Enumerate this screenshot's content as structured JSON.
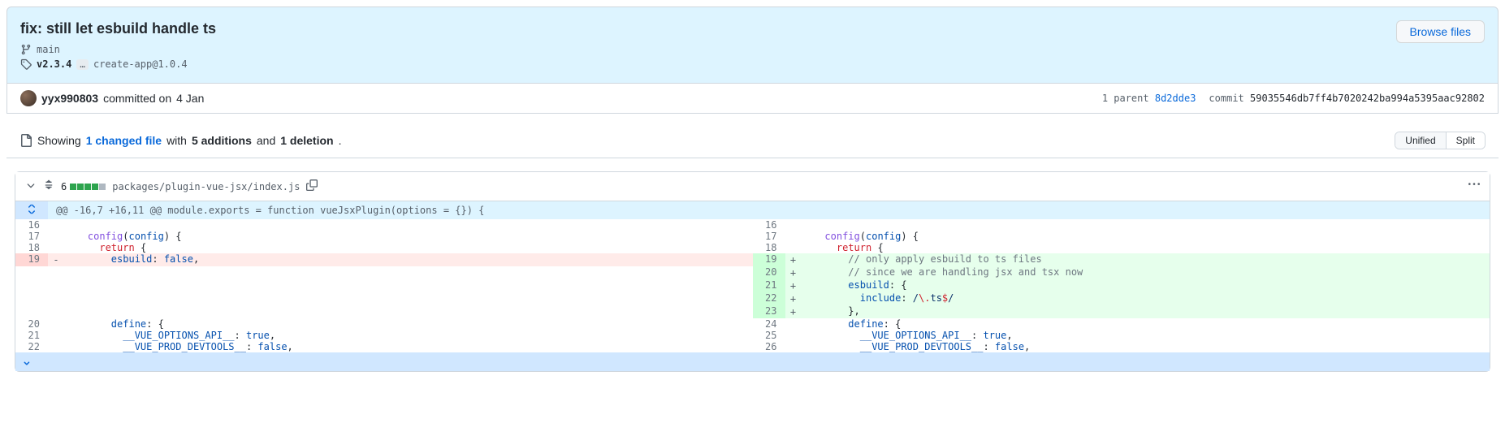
{
  "commit": {
    "title": "fix: still let esbuild handle ts",
    "browse_files": "Browse files",
    "branch": "main",
    "tag_primary": "v2.3.4",
    "tag_more": "…",
    "tag_secondary": "create-app@1.0.4",
    "author": "yyx990803",
    "committed_text": "committed on",
    "date": "4 Jan",
    "parent_label": "1 parent",
    "parent_sha": "8d2dde3",
    "commit_label": "commit",
    "full_sha": "59035546db7ff4b7020242ba994a5395aac92802"
  },
  "toolbar": {
    "showing": "Showing",
    "changed_files": "1 changed file",
    "with": "with",
    "additions": "5 additions",
    "and": "and",
    "deletions": "1 deletion",
    "period": ".",
    "unified": "Unified",
    "split": "Split"
  },
  "file": {
    "count": "6",
    "path": "packages/plugin-vue-jsx/index.js",
    "hunk": "@@ -16,7 +16,11 @@ module.exports = function vueJsxPlugin(options = {}) {"
  },
  "diff": {
    "left": [
      {
        "n": "16",
        "type": "ctx",
        "html": ""
      },
      {
        "n": "17",
        "type": "ctx",
        "html": "    <span class='pl-en'>config</span>(<span class='k-blue'>config</span>) {"
      },
      {
        "n": "18",
        "type": "ctx",
        "html": "      <span class='k-red'>return</span> {"
      },
      {
        "n": "19",
        "type": "del",
        "html": "        <span class='k-blue'>esbuild</span>: <span class='k-blue'>false</span>,"
      },
      {
        "n": "",
        "type": "empty",
        "html": ""
      },
      {
        "n": "",
        "type": "empty",
        "html": ""
      },
      {
        "n": "",
        "type": "empty",
        "html": ""
      },
      {
        "n": "",
        "type": "empty",
        "html": ""
      },
      {
        "n": "20",
        "type": "ctx",
        "html": "        <span class='k-blue'>define</span>: {"
      },
      {
        "n": "21",
        "type": "ctx",
        "html": "          <span class='k-blue'>__VUE_OPTIONS_API__</span>: <span class='k-blue'>true</span>,"
      },
      {
        "n": "22",
        "type": "ctx",
        "html": "          <span class='k-blue'>__VUE_PROD_DEVTOOLS__</span>: <span class='k-blue'>false</span>,"
      }
    ],
    "right": [
      {
        "n": "16",
        "type": "ctx",
        "html": ""
      },
      {
        "n": "17",
        "type": "ctx",
        "html": "    <span class='pl-en'>config</span>(<span class='k-blue'>config</span>) {"
      },
      {
        "n": "18",
        "type": "ctx",
        "html": "      <span class='k-red'>return</span> {"
      },
      {
        "n": "19",
        "type": "add",
        "html": "        <span class='c-grey'>// only apply esbuild to ts files</span>"
      },
      {
        "n": "20",
        "type": "add",
        "html": "        <span class='c-grey'>// since we are handling jsx and tsx now</span>"
      },
      {
        "n": "21",
        "type": "add",
        "html": "        <span class='k-blue'>esbuild</span>: {"
      },
      {
        "n": "22",
        "type": "add",
        "html": "          <span class='k-blue'>include</span>: <span class='s-blue'>/</span><span class='k-red'>\\.</span><span class='s-blue'>ts</span><span class='k-red'>$</span><span class='s-blue'>/</span>"
      },
      {
        "n": "23",
        "type": "add",
        "html": "        },"
      },
      {
        "n": "24",
        "type": "ctx",
        "html": "        <span class='k-blue'>define</span>: {"
      },
      {
        "n": "25",
        "type": "ctx",
        "html": "          <span class='k-blue'>__VUE_OPTIONS_API__</span>: <span class='k-blue'>true</span>,"
      },
      {
        "n": "26",
        "type": "ctx",
        "html": "          <span class='k-blue'>__VUE_PROD_DEVTOOLS__</span>: <span class='k-blue'>false</span>,"
      }
    ]
  }
}
